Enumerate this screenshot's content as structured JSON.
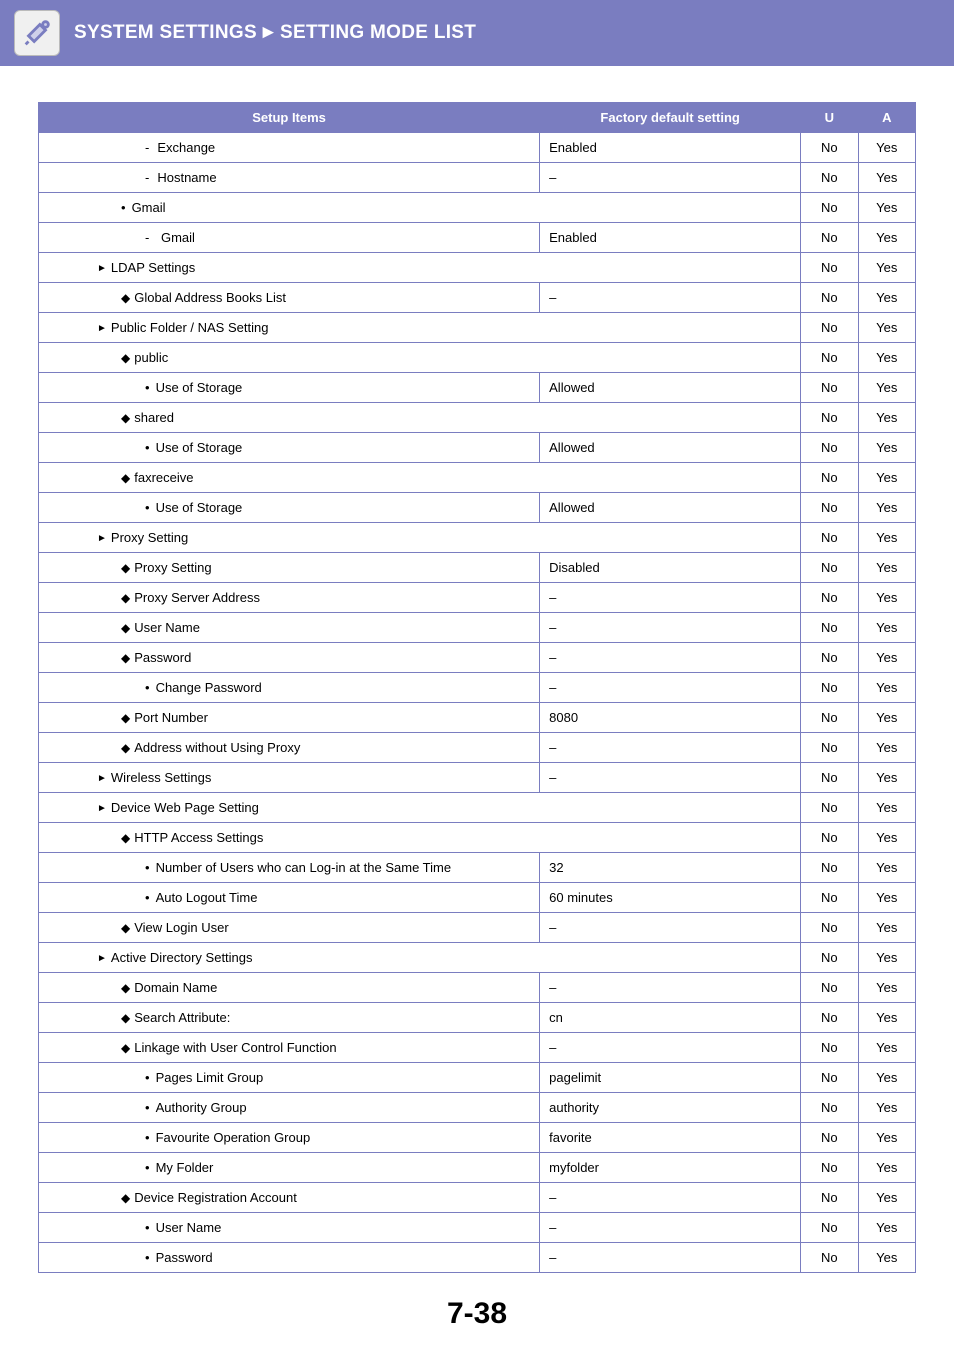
{
  "header": {
    "title_left": "SYSTEM SETTINGS",
    "title_right": "SETTING MODE LIST"
  },
  "columns": {
    "setup": "Setup Items",
    "factory": "Factory default setting",
    "u": "U",
    "a": "A"
  },
  "rows": [
    {
      "indent": 4,
      "mark": "dash",
      "label": "Exchange",
      "value": "Enabled",
      "u": "No",
      "a": "Yes",
      "span": false
    },
    {
      "indent": 4,
      "mark": "dash",
      "label": "Hostname",
      "value": "–",
      "u": "No",
      "a": "Yes",
      "span": false
    },
    {
      "indent": 3,
      "mark": "bullet",
      "label": "Gmail",
      "value": "",
      "u": "No",
      "a": "Yes",
      "span": true
    },
    {
      "indent": 4,
      "mark": "dash",
      "label": " Gmail",
      "value": "Enabled",
      "u": "No",
      "a": "Yes",
      "span": false
    },
    {
      "indent": 2,
      "mark": "tri",
      "label": "LDAP Settings",
      "value": "",
      "u": "No",
      "a": "Yes",
      "span": true
    },
    {
      "indent": 3,
      "mark": "diamond",
      "label": "Global Address Books List",
      "value": "–",
      "u": "No",
      "a": "Yes",
      "span": false
    },
    {
      "indent": 2,
      "mark": "tri",
      "label": "Public Folder / NAS Setting",
      "value": "",
      "u": "No",
      "a": "Yes",
      "span": true
    },
    {
      "indent": 3,
      "mark": "diamond",
      "label": "public",
      "value": "",
      "u": "No",
      "a": "Yes",
      "span": true
    },
    {
      "indent": 4,
      "mark": "bullet",
      "label": "Use of Storage",
      "value": "Allowed",
      "u": "No",
      "a": "Yes",
      "span": false
    },
    {
      "indent": 3,
      "mark": "diamond",
      "label": "shared",
      "value": "",
      "u": "No",
      "a": "Yes",
      "span": true
    },
    {
      "indent": 4,
      "mark": "bullet",
      "label": "Use of Storage",
      "value": "Allowed",
      "u": "No",
      "a": "Yes",
      "span": false
    },
    {
      "indent": 3,
      "mark": "diamond",
      "label": "faxreceive",
      "value": "",
      "u": "No",
      "a": "Yes",
      "span": true
    },
    {
      "indent": 4,
      "mark": "bullet",
      "label": "Use of Storage",
      "value": "Allowed",
      "u": "No",
      "a": "Yes",
      "span": false
    },
    {
      "indent": 2,
      "mark": "tri",
      "label": "Proxy Setting",
      "value": "",
      "u": "No",
      "a": "Yes",
      "span": true
    },
    {
      "indent": 3,
      "mark": "diamond",
      "label": "Proxy Setting",
      "value": "Disabled",
      "u": "No",
      "a": "Yes",
      "span": false
    },
    {
      "indent": 3,
      "mark": "diamond",
      "label": "Proxy Server Address",
      "value": "–",
      "u": "No",
      "a": "Yes",
      "span": false
    },
    {
      "indent": 3,
      "mark": "diamond",
      "label": "User Name",
      "value": "–",
      "u": "No",
      "a": "Yes",
      "span": false
    },
    {
      "indent": 3,
      "mark": "diamond",
      "label": "Password",
      "value": "–",
      "u": "No",
      "a": "Yes",
      "span": false
    },
    {
      "indent": 4,
      "mark": "bullet",
      "label": "Change Password",
      "value": "–",
      "u": "No",
      "a": "Yes",
      "span": false
    },
    {
      "indent": 3,
      "mark": "diamond",
      "label": "Port Number",
      "value": "8080",
      "u": "No",
      "a": "Yes",
      "span": false
    },
    {
      "indent": 3,
      "mark": "diamond",
      "label": "Address without Using Proxy",
      "value": "–",
      "u": "No",
      "a": "Yes",
      "span": false
    },
    {
      "indent": 2,
      "mark": "tri",
      "label": "Wireless Settings",
      "value": "–",
      "u": "No",
      "a": "Yes",
      "span": false
    },
    {
      "indent": 2,
      "mark": "tri",
      "label": "Device Web Page Setting",
      "value": "",
      "u": "No",
      "a": "Yes",
      "span": true
    },
    {
      "indent": 3,
      "mark": "diamond",
      "label": "HTTP Access Settings",
      "value": "",
      "u": "No",
      "a": "Yes",
      "span": true
    },
    {
      "indent": 4,
      "mark": "bullet",
      "label": "Number of Users who can Log-in at the Same Time",
      "value": "32",
      "u": "No",
      "a": "Yes",
      "span": false
    },
    {
      "indent": 4,
      "mark": "bullet",
      "label": "Auto Logout Time",
      "value": "60 minutes",
      "u": "No",
      "a": "Yes",
      "span": false
    },
    {
      "indent": 3,
      "mark": "diamond",
      "label": "View Login User",
      "value": "–",
      "u": "No",
      "a": "Yes",
      "span": false
    },
    {
      "indent": 2,
      "mark": "tri",
      "label": "Active Directory Settings",
      "value": "",
      "u": "No",
      "a": "Yes",
      "span": true
    },
    {
      "indent": 3,
      "mark": "diamond",
      "label": "Domain Name",
      "value": "–",
      "u": "No",
      "a": "Yes",
      "span": false
    },
    {
      "indent": 3,
      "mark": "diamond",
      "label": "Search Attribute:",
      "value": "cn",
      "u": "No",
      "a": "Yes",
      "span": false
    },
    {
      "indent": 3,
      "mark": "diamond",
      "label": "Linkage with User Control Function",
      "value": "–",
      "u": "No",
      "a": "Yes",
      "span": false
    },
    {
      "indent": 4,
      "mark": "bullet",
      "label": "Pages Limit Group",
      "value": "pagelimit",
      "u": "No",
      "a": "Yes",
      "span": false
    },
    {
      "indent": 4,
      "mark": "bullet",
      "label": "Authority Group",
      "value": "authority",
      "u": "No",
      "a": "Yes",
      "span": false
    },
    {
      "indent": 4,
      "mark": "bullet",
      "label": "Favourite Operation Group",
      "value": "favorite",
      "u": "No",
      "a": "Yes",
      "span": false
    },
    {
      "indent": 4,
      "mark": "bullet",
      "label": "My Folder",
      "value": "myfolder",
      "u": "No",
      "a": "Yes",
      "span": false
    },
    {
      "indent": 3,
      "mark": "diamond",
      "label": "Device Registration Account",
      "value": "–",
      "u": "No",
      "a": "Yes",
      "span": false
    },
    {
      "indent": 4,
      "mark": "bullet",
      "label": "User Name",
      "value": "–",
      "u": "No",
      "a": "Yes",
      "span": false
    },
    {
      "indent": 4,
      "mark": "bullet",
      "label": "Password",
      "value": "–",
      "u": "No",
      "a": "Yes",
      "span": false
    }
  ],
  "page_number": "7-38"
}
